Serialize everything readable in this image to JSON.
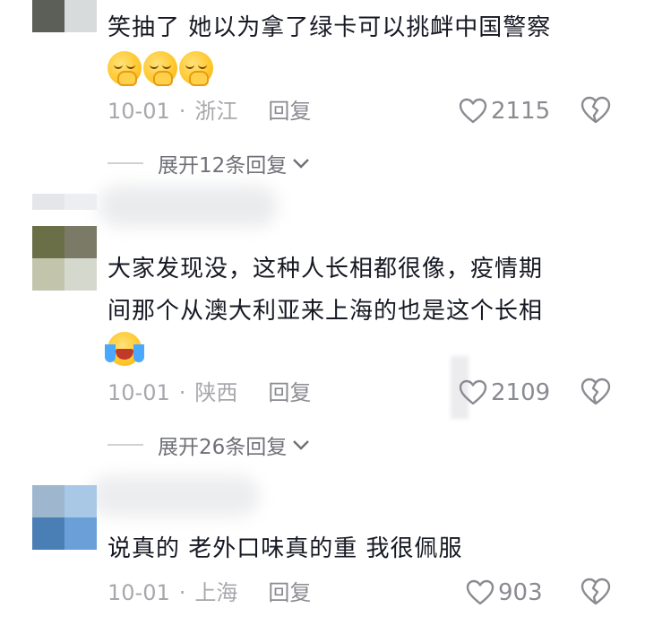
{
  "comments": [
    {
      "text": "笑抽了  她以为拿了绿卡可以挑衅中国警察",
      "emojis": [
        "hand-over-mouth-emoji",
        "hand-over-mouth-emoji",
        "hand-over-mouth-emoji"
      ],
      "date": "10-01",
      "separator": "·",
      "location": "浙江",
      "reply_label": "回复",
      "likes": "2115",
      "expand_label": "展开12条回复"
    },
    {
      "text_lines": [
        "大家发现没，这种人长相都很像，疫情期",
        "间那个从澳大利亚来上海的也是这个长相"
      ],
      "emojis": [
        "crying-laughing-emoji"
      ],
      "date": "10-01",
      "separator": "·",
      "location": "陕西",
      "reply_label": "回复",
      "likes": "2109",
      "expand_label": "展开26条回复"
    },
    {
      "text": "说真的  老外口味真的重  我很佩服",
      "date": "10-01",
      "separator": "·",
      "location": "上海",
      "reply_label": "回复",
      "likes": "903"
    }
  ],
  "colors": {
    "text": "#161823",
    "meta": "#a7a8ad",
    "action": "#8a8b91",
    "avatar1": [
      "#5b5f57",
      "#d8dbdc"
    ],
    "avatar2": [
      "#6a6f47",
      "#7a7a66",
      "#c2c5ac",
      "#d5d8cd"
    ],
    "avatar3": [
      "#9fb6cf",
      "#a9c8e6",
      "#4a7fb5",
      "#6a9fd8"
    ]
  }
}
